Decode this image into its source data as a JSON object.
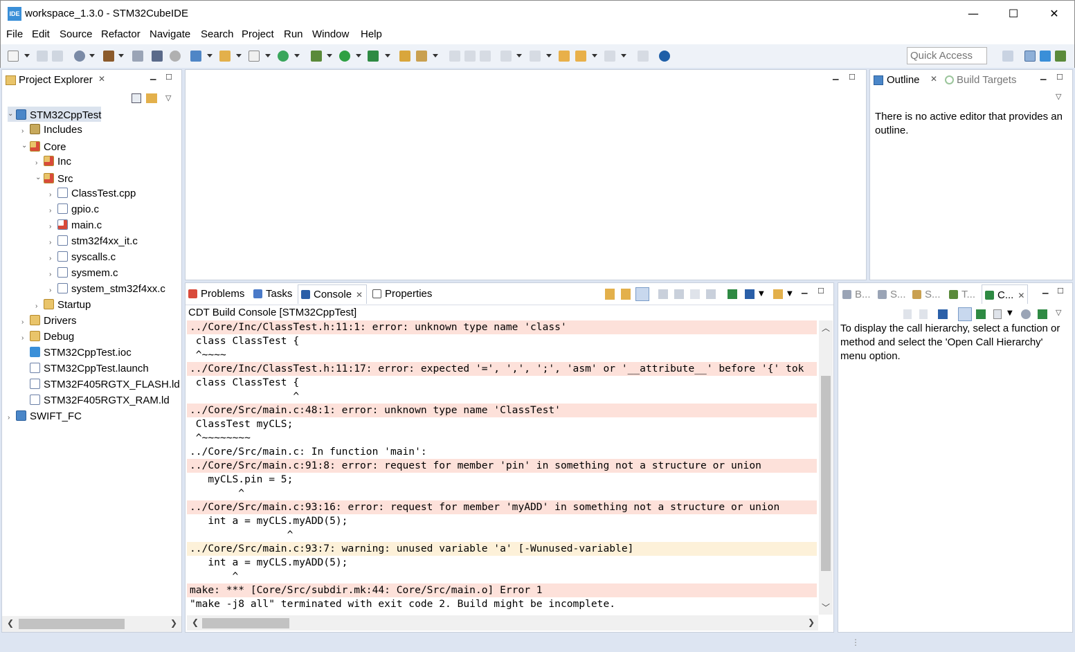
{
  "window": {
    "title": "workspace_1.3.0 - STM32CubeIDE",
    "icon_text": "IDE",
    "minimize": "—",
    "maximize": "☐",
    "close": "✕"
  },
  "menu": [
    "File",
    "Edit",
    "Source",
    "Refactor",
    "Navigate",
    "Search",
    "Project",
    "Run",
    "Window",
    "Help"
  ],
  "toolbar": {
    "quick_access_placeholder": "Quick Access"
  },
  "project_explorer": {
    "title": "Project Explorer",
    "tree": [
      {
        "label": "STM32CppTest",
        "icon": "project-icon",
        "expanded": true,
        "level": 0
      },
      {
        "label": "Includes",
        "icon": "includes-icon",
        "expanded": false,
        "level": 1
      },
      {
        "label": "Core",
        "icon": "source-folder-icon",
        "expanded": true,
        "level": 1
      },
      {
        "label": "Inc",
        "icon": "source-folder-icon",
        "expanded": false,
        "level": 2
      },
      {
        "label": "Src",
        "icon": "source-folder-icon",
        "expanded": true,
        "level": 2
      },
      {
        "label": "ClassTest.cpp",
        "icon": "cpp-file-icon",
        "expanded": false,
        "level": 3
      },
      {
        "label": "gpio.c",
        "icon": "c-file-icon",
        "expanded": false,
        "level": 3
      },
      {
        "label": "main.c",
        "icon": "c-file-error-icon",
        "expanded": false,
        "level": 3
      },
      {
        "label": "stm32f4xx_it.c",
        "icon": "c-file-icon",
        "expanded": false,
        "level": 3
      },
      {
        "label": "syscalls.c",
        "icon": "c-file-icon",
        "expanded": false,
        "level": 3
      },
      {
        "label": "sysmem.c",
        "icon": "c-file-icon",
        "expanded": false,
        "level": 3
      },
      {
        "label": "system_stm32f4xx.c",
        "icon": "c-file-icon",
        "expanded": false,
        "level": 3
      },
      {
        "label": "Startup",
        "icon": "folder-icon",
        "expanded": false,
        "level": 2
      },
      {
        "label": "Drivers",
        "icon": "folder-icon",
        "expanded": false,
        "level": 1
      },
      {
        "label": "Debug",
        "icon": "folder-icon",
        "expanded": false,
        "level": 1
      },
      {
        "label": "STM32CppTest.ioc",
        "icon": "mx-file-icon",
        "expanded": null,
        "level": 1
      },
      {
        "label": "STM32CppTest.launch",
        "icon": "file-icon",
        "expanded": null,
        "level": 1
      },
      {
        "label": "STM32F405RGTX_FLASH.ld",
        "icon": "file-icon",
        "expanded": null,
        "level": 1
      },
      {
        "label": "STM32F405RGTX_RAM.ld",
        "icon": "file-icon",
        "expanded": null,
        "level": 1
      },
      {
        "label": "SWIFT_FC",
        "icon": "project-icon",
        "expanded": false,
        "level": 0
      }
    ]
  },
  "outline": {
    "tab_outline": "Outline",
    "tab_build_targets": "Build Targets",
    "message": "There is no active editor that provides an outline."
  },
  "bottom_tabs": {
    "problems": "Problems",
    "tasks": "Tasks",
    "console": "Console",
    "properties": "Properties"
  },
  "console": {
    "header": "CDT Build Console [STM32CppTest]",
    "lines": [
      {
        "text": "../Core/Inc/ClassTest.h:11:1: error: unknown type name 'class'",
        "kind": "err"
      },
      {
        "text": " class ClassTest {",
        "kind": "plain"
      },
      {
        "text": " ^~~~~",
        "kind": "plain"
      },
      {
        "text": "../Core/Inc/ClassTest.h:11:17: error: expected '=', ',', ';', 'asm' or '__attribute__' before '{' tok",
        "kind": "err"
      },
      {
        "text": " class ClassTest {",
        "kind": "plain"
      },
      {
        "text": "                 ^",
        "kind": "plain"
      },
      {
        "text": "../Core/Src/main.c:48:1: error: unknown type name 'ClassTest'",
        "kind": "err"
      },
      {
        "text": " ClassTest myCLS;",
        "kind": "plain"
      },
      {
        "text": " ^~~~~~~~~",
        "kind": "plain"
      },
      {
        "text": "../Core/Src/main.c: In function 'main':",
        "kind": "plain"
      },
      {
        "text": "../Core/Src/main.c:91:8: error: request for member 'pin' in something not a structure or union",
        "kind": "err"
      },
      {
        "text": "   myCLS.pin = 5;",
        "kind": "plain"
      },
      {
        "text": "        ^",
        "kind": "plain"
      },
      {
        "text": "../Core/Src/main.c:93:16: error: request for member 'myADD' in something not a structure or union",
        "kind": "err"
      },
      {
        "text": "   int a = myCLS.myADD(5);",
        "kind": "plain"
      },
      {
        "text": "                ^",
        "kind": "plain"
      },
      {
        "text": "../Core/Src/main.c:93:7: warning: unused variable 'a' [-Wunused-variable]",
        "kind": "warn"
      },
      {
        "text": "   int a = myCLS.myADD(5);",
        "kind": "plain"
      },
      {
        "text": "       ^",
        "kind": "plain"
      },
      {
        "text": "make: *** [Core/Src/subdir.mk:44: Core/Src/main.o] Error 1",
        "kind": "err"
      },
      {
        "text": "\"make -j8 all\" terminated with exit code 2. Build might be incomplete.",
        "kind": "plain"
      }
    ]
  },
  "call_hierarchy": {
    "tabs": [
      "B...",
      "S...",
      "S...",
      "T...",
      "C..."
    ],
    "message": "To display the call hierarchy, select a function or method and select the 'Open Call Hierarchy' menu option."
  }
}
